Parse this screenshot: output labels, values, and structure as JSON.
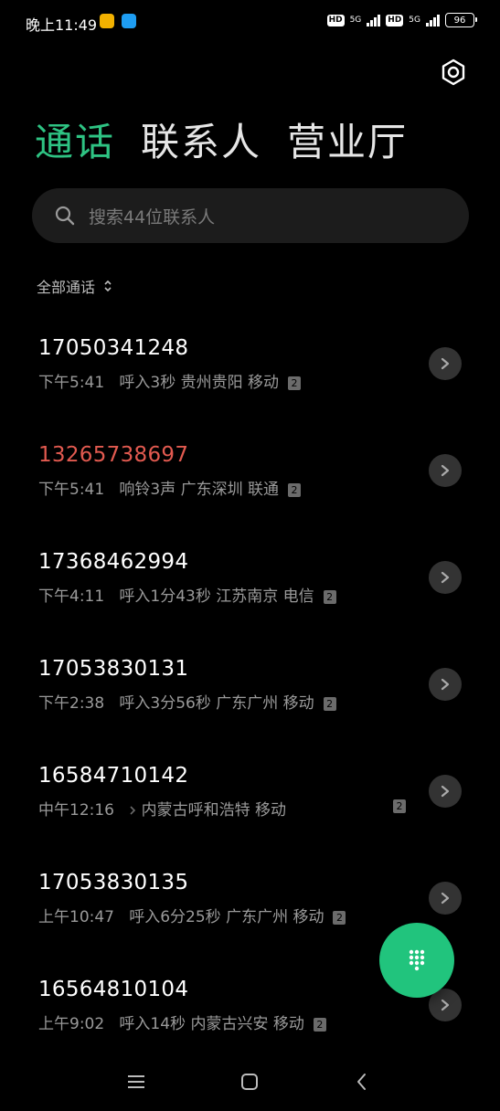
{
  "status_bar": {
    "time": "晚上11:49",
    "network_1": "5G",
    "network_2": "5G",
    "hd_1": "HD",
    "hd_2": "HD",
    "battery": "96"
  },
  "tabs": [
    {
      "label": "通话",
      "active": true
    },
    {
      "label": "联系人",
      "active": false
    },
    {
      "label": "营业厅",
      "active": false
    }
  ],
  "search": {
    "placeholder": "搜索44位联系人"
  },
  "filter": {
    "label": "全部通话"
  },
  "calls": [
    {
      "number": "17050341248",
      "time": "下午5:41",
      "type": "呼入3秒",
      "location": "贵州贵阳",
      "carrier": "移动",
      "sim": "2",
      "missed": false
    },
    {
      "number": "13265738697",
      "time": "下午5:41",
      "type": "响铃3声",
      "location": "广东深圳",
      "carrier": "联通",
      "sim": "2",
      "missed": true
    },
    {
      "number": "17368462994",
      "time": "下午4:11",
      "type": "呼入1分43秒",
      "location": "江苏南京",
      "carrier": "电信",
      "sim": "2",
      "missed": false
    },
    {
      "number": "17053830131",
      "time": "下午2:38",
      "type": "呼入3分56秒",
      "location": "广东广州",
      "carrier": "移动",
      "sim": "2",
      "missed": false
    },
    {
      "number": "16584710142",
      "time": "中午12:16",
      "type": "",
      "location": "内蒙古呼和浩特",
      "carrier": "移动",
      "sim": "2",
      "missed": false
    },
    {
      "number": "17053830135",
      "time": "上午10:47",
      "type": "呼入6分25秒",
      "location": "广东广州",
      "carrier": "移动",
      "sim": "2",
      "missed": false
    },
    {
      "number": "16564810104",
      "time": "上午9:02",
      "type": "呼入14秒",
      "location": "内蒙古兴安",
      "carrier": "移动",
      "sim": "2",
      "missed": false
    }
  ],
  "colors": {
    "accent": "#2ec383",
    "missed": "#e25a50",
    "fab": "#21c47d"
  },
  "icons": {
    "settings": "gear-icon",
    "search": "search-icon",
    "filter": "sort-updown-icon",
    "info": "chevron-right-icon",
    "dialpad": "dialpad-icon",
    "nav_menu": "menu-icon",
    "nav_home": "home-square-icon",
    "nav_back": "back-chevron-icon"
  }
}
